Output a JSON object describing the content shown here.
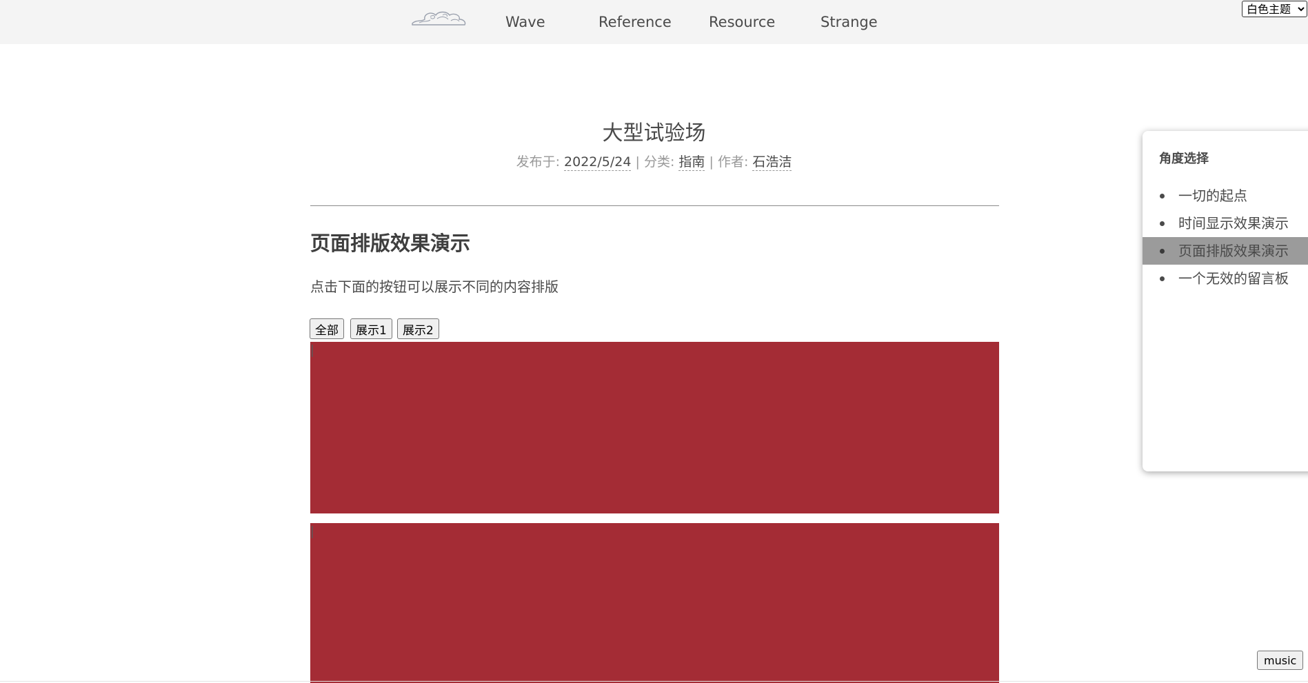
{
  "nav": {
    "logo_icon": "cloud-logo-icon",
    "links": [
      "Wave",
      "Reference",
      "Resource",
      "Strange"
    ]
  },
  "theme_select": {
    "selected": "白色主题"
  },
  "post": {
    "title": "大型试验场",
    "meta": {
      "published_label": "发布于:",
      "date": "2022/5/24",
      "sep1": "|",
      "category_label": "分类:",
      "category": "指南",
      "sep2": "|",
      "author_label": "作者:",
      "author": "石浩洁"
    }
  },
  "section": {
    "heading": "页面排版效果演示",
    "intro": "点击下面的按钮可以展示不同的内容排版",
    "buttons": [
      "全部",
      "展示1",
      "展示2"
    ],
    "block_color": "#a42c35"
  },
  "toc": {
    "title": "角度选择",
    "items": [
      {
        "label": "一切的起点",
        "active": false
      },
      {
        "label": "时间显示效果演示",
        "active": false
      },
      {
        "label": "页面排版效果演示",
        "active": true
      },
      {
        "label": "一个无效的留言板",
        "active": false
      }
    ]
  },
  "music_button": "music"
}
